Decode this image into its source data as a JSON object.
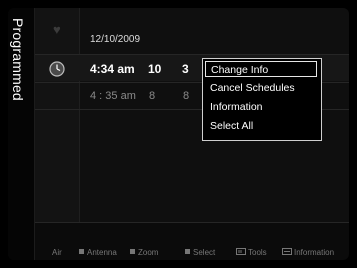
{
  "sidebar": {
    "label": "Programmed"
  },
  "header": {
    "date": "12/10/2009"
  },
  "rows": [
    {
      "time": "4:34 am",
      "col2": "10",
      "col3": "3"
    },
    {
      "time": "4 : 35 am",
      "col2": "8",
      "col3": "8"
    }
  ],
  "context_menu": {
    "items": [
      "Change Info",
      "Cancel Schedules",
      "Information",
      "Select All"
    ],
    "highlighted_index": 0
  },
  "bottom_bar": {
    "air": "Air",
    "antenna": "Antenna",
    "zoom": "Zoom",
    "select": "Select",
    "tools": "Tools",
    "information": "Information"
  },
  "icons": [
    "heart-icon",
    "clock-icon",
    "tools-icon",
    "info-icon"
  ]
}
